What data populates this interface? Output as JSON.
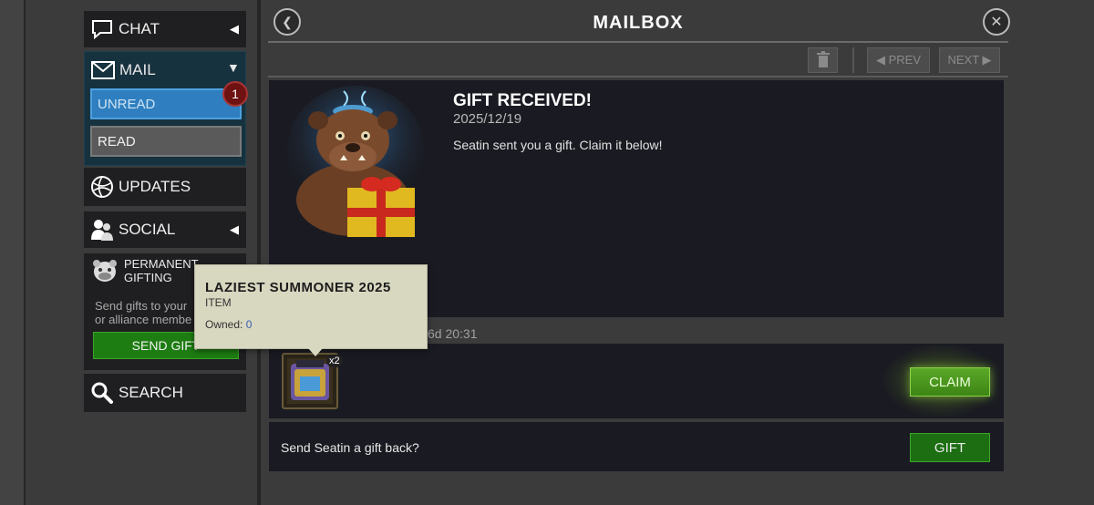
{
  "sidebar": {
    "chat": {
      "label": "CHAT",
      "icon": "chat-bubble-icon"
    },
    "mail": {
      "label": "MAIL",
      "icon": "envelope-icon"
    },
    "unread": {
      "label": "UNREAD",
      "badge": "1"
    },
    "read": {
      "label": "READ"
    },
    "updates": {
      "label": "UPDATES",
      "icon": "globe-icon"
    },
    "social": {
      "label": "SOCIAL",
      "icon": "people-icon"
    },
    "gifting": {
      "title_line1": "PERMANENT",
      "title_line2": "GIFTING",
      "desc_line1": "Send gifts to your",
      "desc_line2": "or alliance membe",
      "button": "SEND GIFT",
      "icon": "bulldog-icon"
    },
    "search": {
      "label": "SEARCH",
      "icon": "magnifier-icon"
    }
  },
  "header": {
    "title": "MAILBOX",
    "prev": "◀ PREV",
    "next": "NEXT ▶"
  },
  "message": {
    "title": "GIFT RECEIVED!",
    "date": "2025/12/19",
    "body": "Seatin sent you a gift. Claim it below!",
    "expires": "6d 20:31"
  },
  "reward": {
    "count": "x2",
    "claim": "CLAIM"
  },
  "giftback": {
    "text": "Send Seatin a gift back?",
    "button": "GIFT"
  },
  "tooltip": {
    "title": "LAZIEST SUMMONER 2025",
    "type": "ITEM",
    "owned_label": "Owned: ",
    "owned_value": "0"
  },
  "colors": {
    "unread_blue": "#2f7fc0",
    "claim_green": "#5aa828",
    "gift_green": "#1d6e12",
    "badge_red": "#6e1212",
    "panel_bg": "#1a1b22"
  }
}
